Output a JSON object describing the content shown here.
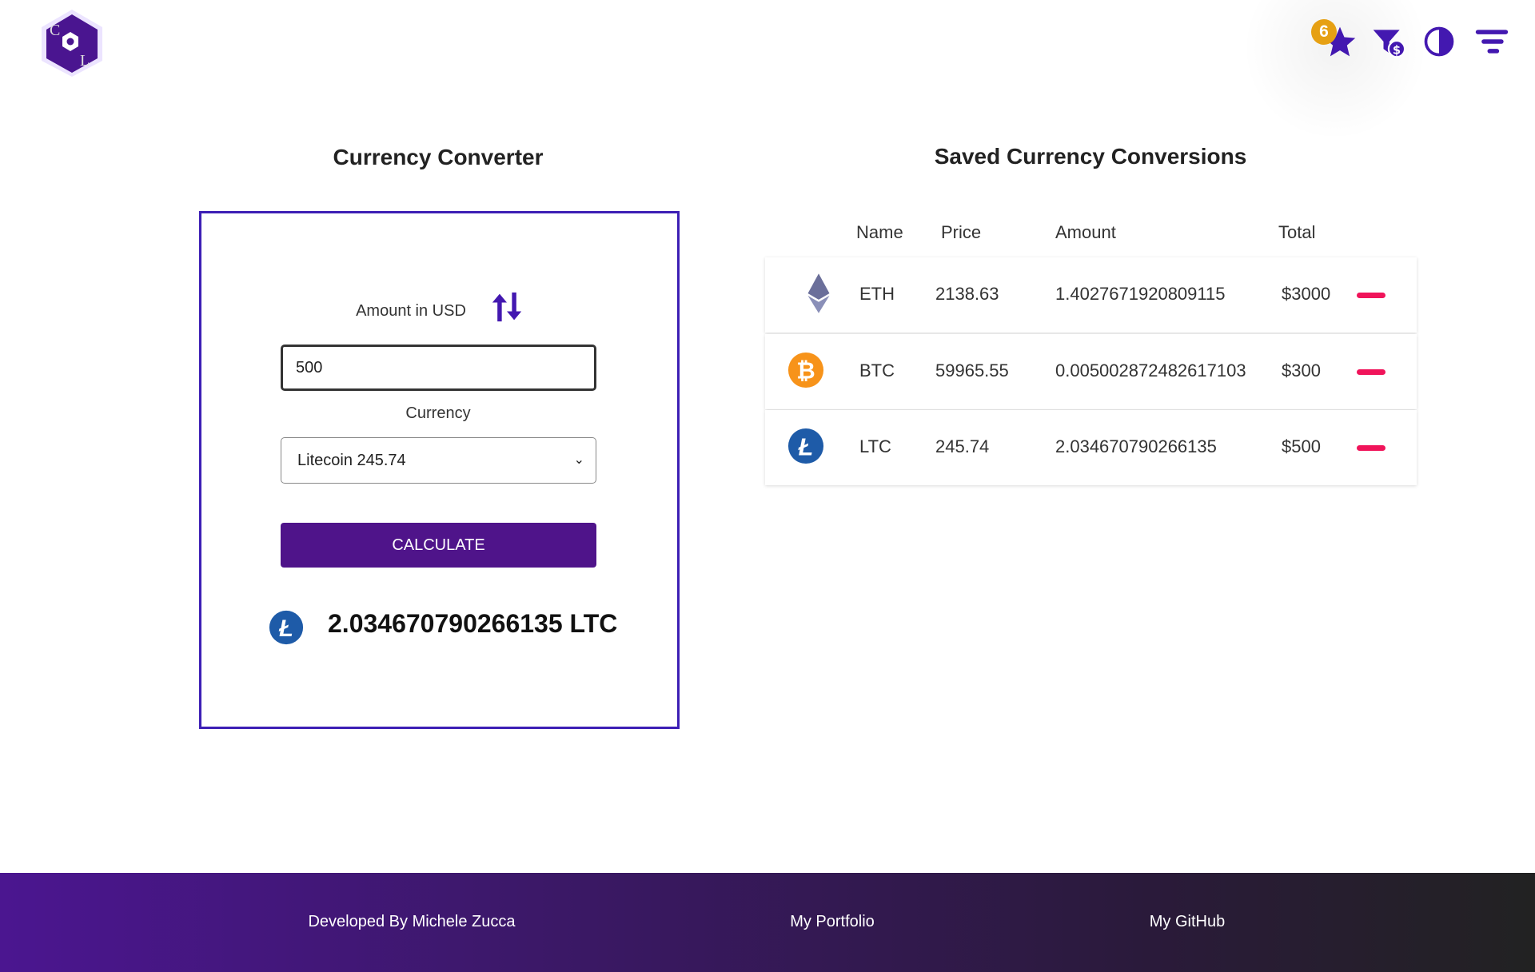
{
  "header": {
    "logo_text": "CL",
    "favorites_count": "6"
  },
  "converter": {
    "title": "Currency Converter",
    "amount_label": "Amount in USD",
    "amount_value": "500",
    "currency_label": "Currency",
    "currency_selected": "Litecoin 245.74",
    "calculate_label": "CALCULATE",
    "result": "2.034670790266135 LTC",
    "result_icon": "litecoin-icon"
  },
  "saved": {
    "title": "Saved Currency Conversions",
    "columns": [
      "Name",
      "Price",
      "Amount",
      "Total"
    ],
    "rows": [
      {
        "icon": "ethereum-icon",
        "name": "ETH",
        "price": "2138.63",
        "amount": "1.4027671920809115",
        "total": "$3000"
      },
      {
        "icon": "bitcoin-icon",
        "name": "BTC",
        "price": "59965.55",
        "amount": "0.005002872482617103",
        "total": "$300"
      },
      {
        "icon": "litecoin-icon",
        "name": "LTC",
        "price": "245.74",
        "amount": "2.034670790266135",
        "total": "$500"
      }
    ]
  },
  "footer": {
    "developer": "Developed By Michele Zucca",
    "portfolio": "My Portfolio",
    "github": "My GitHub"
  },
  "colors": {
    "primary": "#4f148a",
    "accent": "#3d1fb5",
    "badge": "#e6a013",
    "remove": "#f0145a"
  }
}
